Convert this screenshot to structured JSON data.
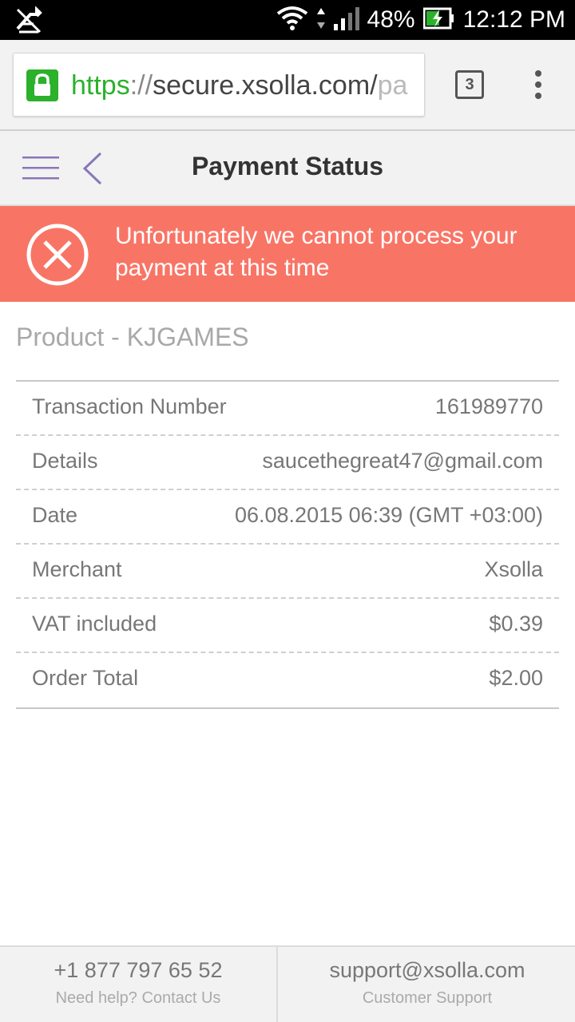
{
  "status_bar": {
    "battery": "48%",
    "time": "12:12 PM"
  },
  "browser": {
    "url_scheme": "https",
    "url_sep": "://",
    "url_host": "secure.xsolla.com/",
    "url_tail": "pa",
    "tab_count": "3"
  },
  "header": {
    "title": "Payment Status"
  },
  "banner": {
    "message": "Unfortunately we cannot process your payment at this time",
    "color": "#f87566"
  },
  "product": {
    "label": "Product - KJGAMES"
  },
  "details": [
    {
      "label": "Transaction Number",
      "value": "161989770"
    },
    {
      "label": "Details",
      "value": "saucethegreat47@gmail.com"
    },
    {
      "label": "Date",
      "value": "06.08.2015 06:39 (GMT +03:00)"
    },
    {
      "label": "Merchant",
      "value": "Xsolla"
    },
    {
      "label": "VAT included",
      "value": "$0.39"
    },
    {
      "label": "Order Total",
      "value": "$2.00"
    }
  ],
  "footer": {
    "phone": "+1 877 797 65 52",
    "phone_caption": "Need help? Contact Us",
    "email": "support@xsolla.com",
    "email_caption": "Customer Support"
  },
  "icons": {
    "lock": "lock-icon",
    "menu": "hamburger-menu-icon",
    "back": "chevron-left-icon",
    "error": "close-circle-icon"
  }
}
